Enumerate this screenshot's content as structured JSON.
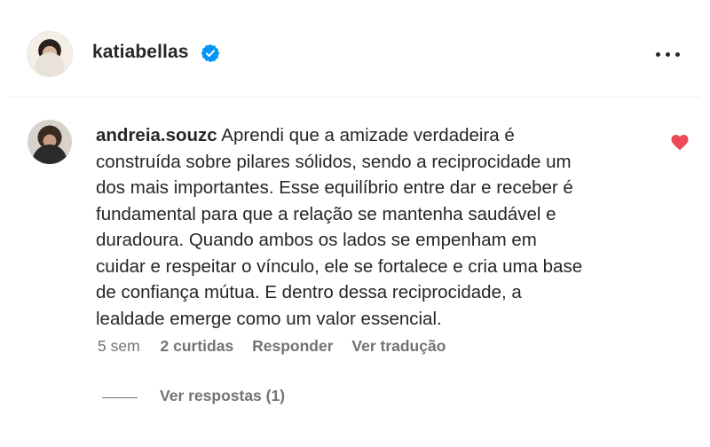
{
  "header": {
    "username": "katiabellas",
    "verified": true,
    "accent_color": "#0095f6"
  },
  "comment": {
    "author": "andreia.souzc",
    "text_lines": [
      "Aprendi que a amizade verdadeira é",
      "construída sobre pilares sólidos, sendo a reciprocidade um",
      "dos mais importantes. Esse equilíbrio entre dar e receber é",
      "fundamental para que a relação se mantenha saudável e",
      "duradoura. Quando ambos os lados se empenham em",
      "cuidar e respeitar o vínculo, ele se fortalece e cria uma base",
      "de confiança mútua. E dentro dessa reciprocidade, a",
      "lealdade emerge como um valor essencial."
    ],
    "liked": true,
    "heart_color": "#ed4956",
    "time": "5 sem",
    "likes": "2 curtidas",
    "reply_label": "Responder",
    "translate_label": "Ver tradução",
    "view_replies": "Ver respostas (1)"
  }
}
